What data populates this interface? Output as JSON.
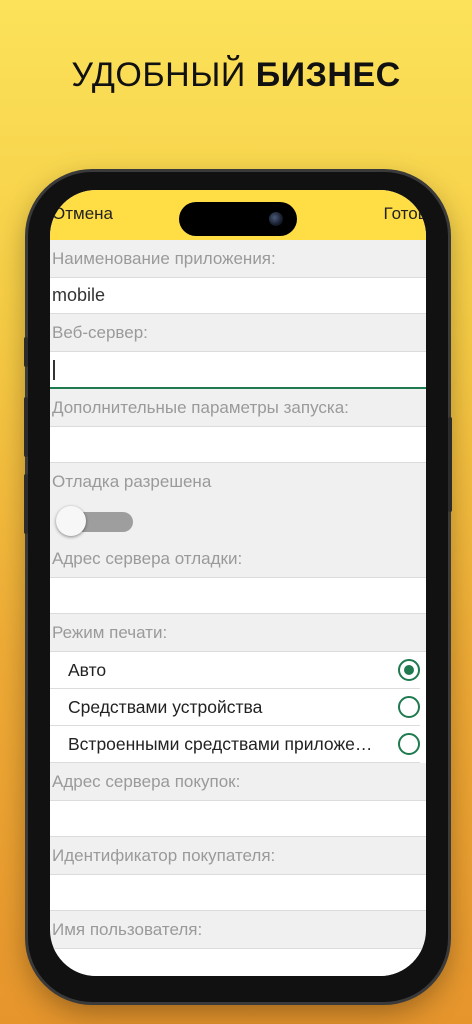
{
  "promo": {
    "headline_regular": "УДОБНЫЙ",
    "headline_bold": "БИЗНЕС"
  },
  "topbar": {
    "cancel_label": "Отмена",
    "done_label": "Готово"
  },
  "form": {
    "app_name_label": "Наименование приложения:",
    "app_name_value": "mobile",
    "web_server_label": "Веб-сервер:",
    "web_server_value": "",
    "launch_params_label": "Дополнительные параметры запуска:",
    "launch_params_value": "",
    "debug_allowed_label": "Отладка разрешена",
    "debug_allowed_value": false,
    "debug_server_label": "Адрес сервера отладки:",
    "debug_server_value": "",
    "print_mode_label": "Режим печати:",
    "print_mode_options": [
      {
        "label": "Авто",
        "selected": true
      },
      {
        "label": "Средствами устройства",
        "selected": false
      },
      {
        "label": "Встроенными средствами приложения",
        "selected": false
      }
    ],
    "purchase_server_label": "Адрес сервера покупок:",
    "purchase_server_value": "",
    "buyer_id_label": "Идентификатор покупателя:",
    "buyer_id_value": "",
    "username_label": "Имя пользователя:",
    "username_value": ""
  },
  "colors": {
    "accent": "#1f7a4f",
    "topbar": "#ffdd45",
    "background_top": "#fbe25a",
    "background_bottom": "#e6952c"
  }
}
